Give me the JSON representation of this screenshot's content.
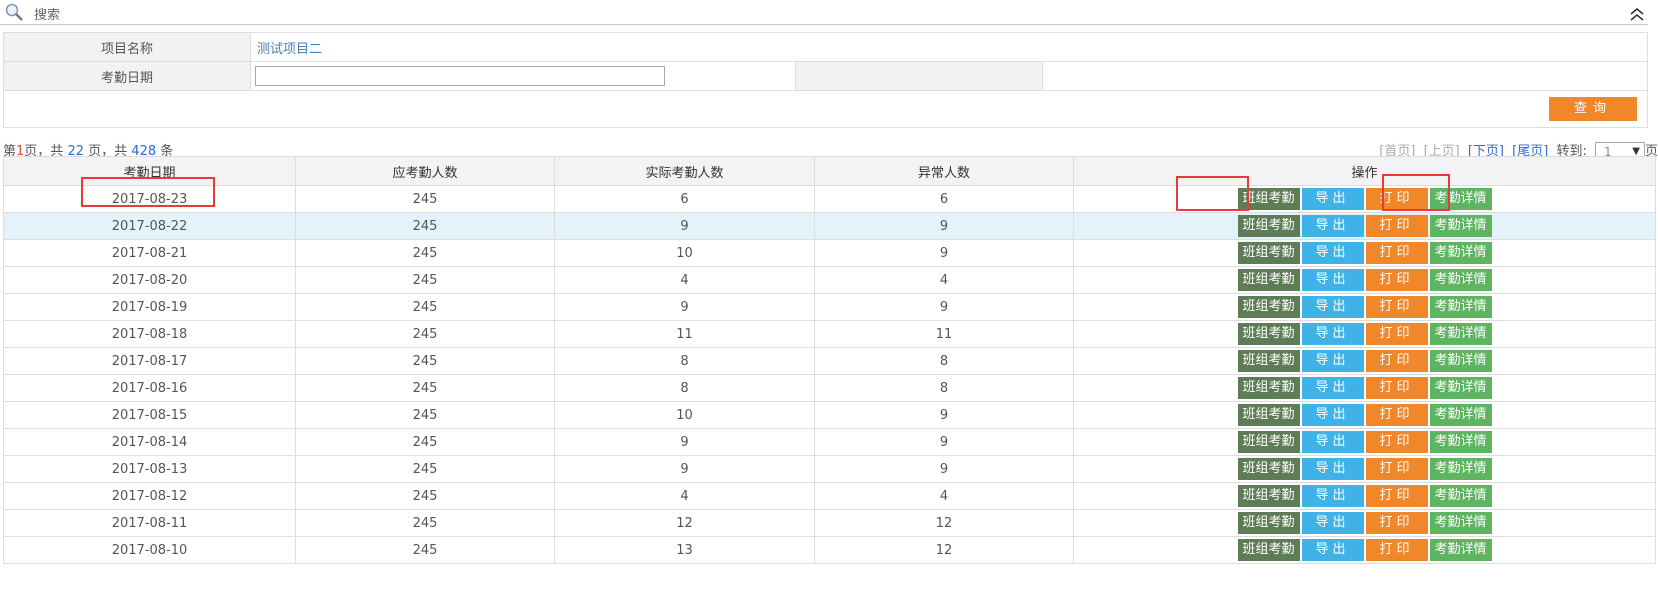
{
  "panel": {
    "title": "搜索",
    "search_icon": "search-icon",
    "collapse_icon": "double-chevron-up-icon"
  },
  "form": {
    "project_label": "项目名称",
    "project_value": "测试项目二",
    "date_label": "考勤日期",
    "date_value": "",
    "query_button": "查询"
  },
  "pager": {
    "prefix": "第",
    "current": "1",
    "page_unit": "页，共",
    "total_pages": "22",
    "mid": "页，共",
    "total_records": "428",
    "suffix": "条",
    "first": "[首页]",
    "prev": "[上页]",
    "next": "[下页]",
    "last": "[尾页]",
    "goto_label": "转到:",
    "goto_value": "1",
    "goto_suffix": "页"
  },
  "table": {
    "headers": [
      "考勤日期",
      "应考勤人数",
      "实际考勤人数",
      "异常人数",
      "操作"
    ],
    "action_labels": [
      "班组考勤",
      "导出",
      "打印",
      "考勤详情"
    ],
    "rows": [
      [
        "2017-08-23",
        "245",
        "6",
        "6"
      ],
      [
        "2017-08-22",
        "245",
        "9",
        "9"
      ],
      [
        "2017-08-21",
        "245",
        "10",
        "9"
      ],
      [
        "2017-08-20",
        "245",
        "4",
        "4"
      ],
      [
        "2017-08-19",
        "245",
        "9",
        "9"
      ],
      [
        "2017-08-18",
        "245",
        "11",
        "11"
      ],
      [
        "2017-08-17",
        "245",
        "8",
        "8"
      ],
      [
        "2017-08-16",
        "245",
        "8",
        "8"
      ],
      [
        "2017-08-15",
        "245",
        "10",
        "9"
      ],
      [
        "2017-08-14",
        "245",
        "9",
        "9"
      ],
      [
        "2017-08-13",
        "245",
        "9",
        "9"
      ],
      [
        "2017-08-12",
        "245",
        "4",
        "4"
      ],
      [
        "2017-08-11",
        "245",
        "12",
        "12"
      ],
      [
        "2017-08-10",
        "245",
        "13",
        "12"
      ]
    ]
  },
  "colors": {
    "query": "#f0872a",
    "group_btn": "#5e7d57",
    "export_btn": "#3fb3e8",
    "print_btn": "#f0872a",
    "detail_btn": "#5fb462",
    "highlight": "#e83a3a"
  }
}
